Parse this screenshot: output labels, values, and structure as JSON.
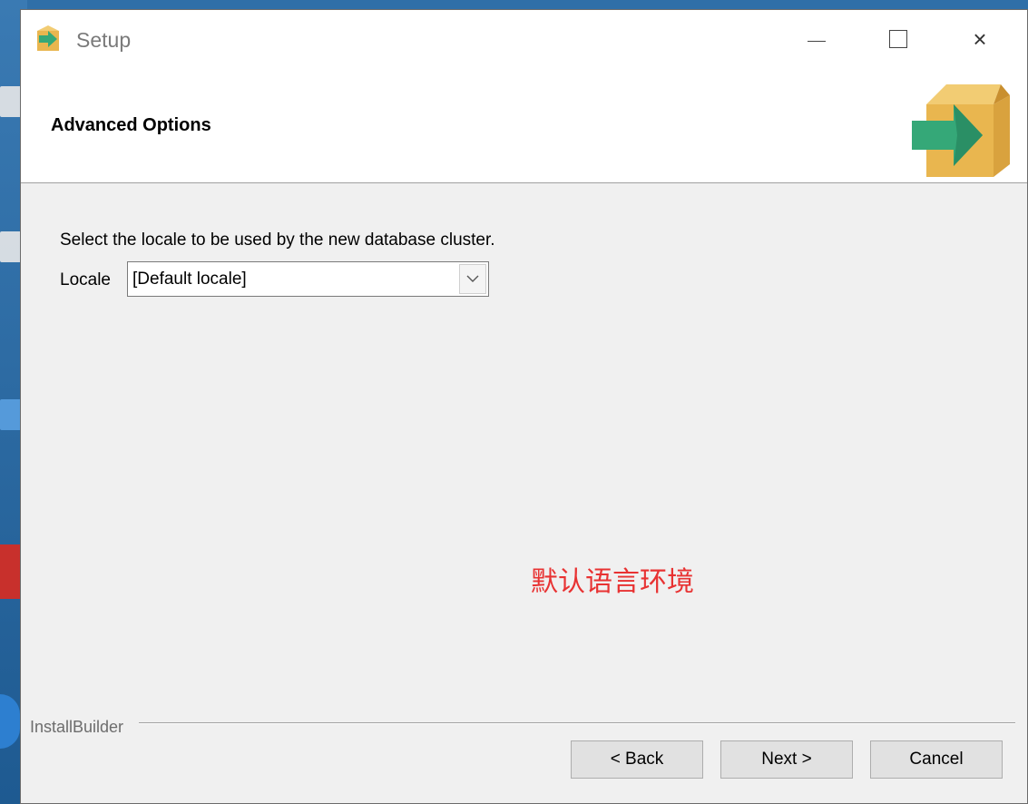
{
  "window": {
    "title": "Setup",
    "controls": {
      "minimize": "minimize",
      "maximize": "maximize",
      "close": "×"
    }
  },
  "header": {
    "title": "Advanced Options"
  },
  "main": {
    "prompt": "Select the locale to be used by the new database cluster.",
    "locale_label": "Locale",
    "locale_value": "[Default locale]",
    "annotation": "默认语言环境"
  },
  "footer": {
    "brand": "InstallBuilder",
    "back_label": "< Back",
    "next_label": "Next >",
    "cancel_label": "Cancel"
  },
  "colors": {
    "annotation": "#e83232",
    "box": "#e9b64f",
    "arrow": "#35a878"
  },
  "icons": [
    "setup-box-icon",
    "chevron-down-icon"
  ]
}
